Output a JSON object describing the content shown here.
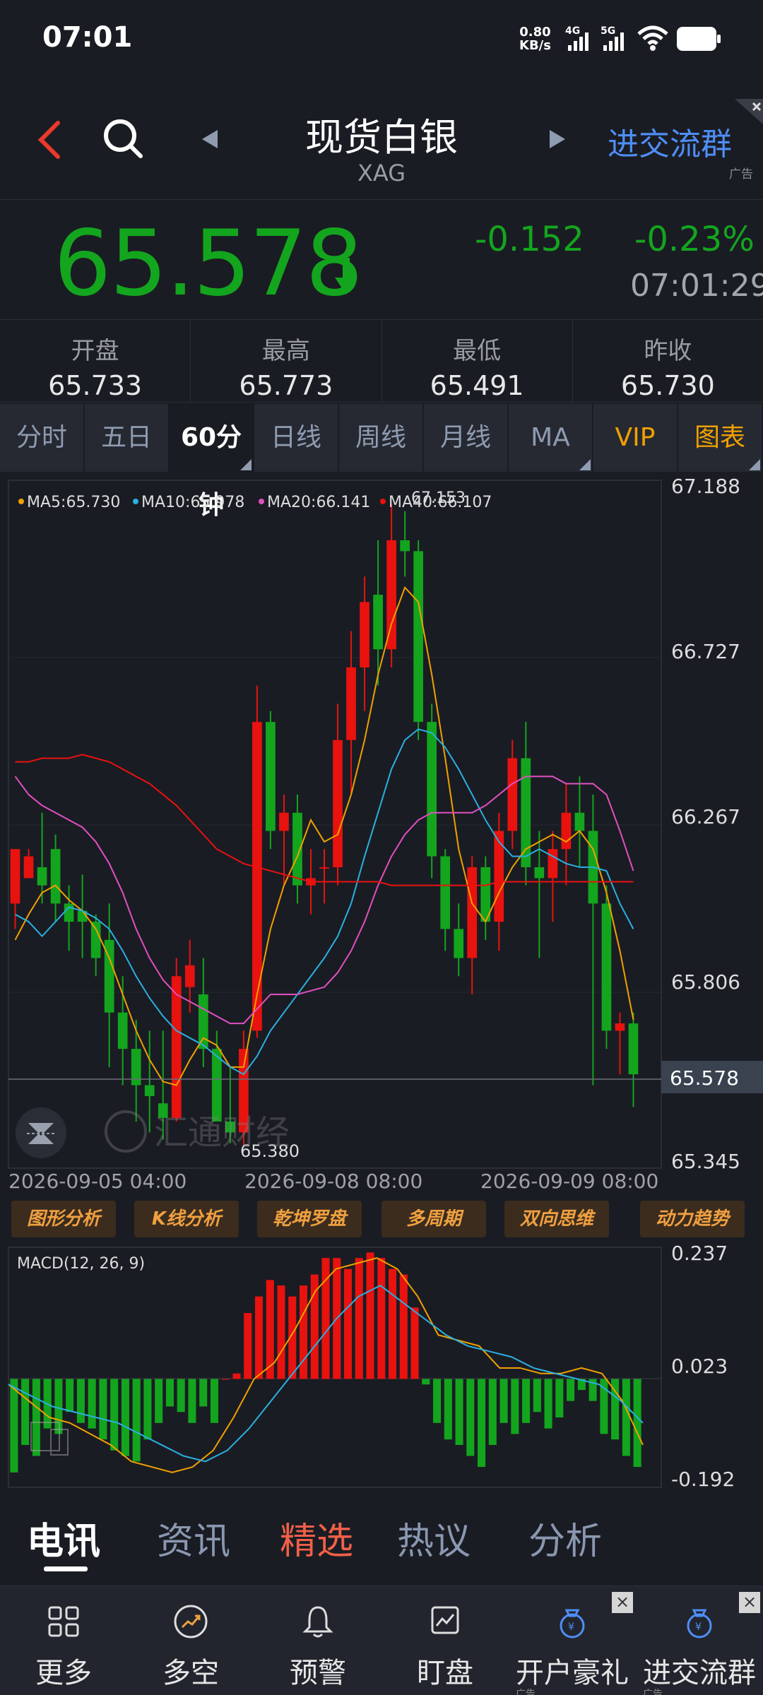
{
  "status": {
    "time": "07:01",
    "net_speed": "0.80",
    "net_unit": "KB/s",
    "sig1": "4G",
    "sig2": "5G"
  },
  "header": {
    "title": "现货白银",
    "subtitle": "XAG",
    "ad_link": "进交流群",
    "ad_tag": "广告"
  },
  "price": {
    "last": "65.578",
    "change": "-0.152",
    "change_pct": "-0.23%",
    "time": "07:01:29",
    "colors": {
      "down": "#13a51e",
      "up": "#e8120f"
    }
  },
  "ohlc": [
    {
      "label": "开盘",
      "value": "65.733"
    },
    {
      "label": "最高",
      "value": "65.773"
    },
    {
      "label": "最低",
      "value": "65.491"
    },
    {
      "label": "昨收",
      "value": "65.730"
    }
  ],
  "tabs": [
    "分时",
    "五日",
    "60分钟",
    "日线",
    "周线",
    "月线",
    "MA",
    "VIP",
    "图表"
  ],
  "ma_legend": [
    {
      "label": "MA5:65.730",
      "color": "#f0a000"
    },
    {
      "label": "MA10:65.978",
      "color": "#2ab0e0"
    },
    {
      "label": "MA20:66.141",
      "color": "#e050c0"
    },
    {
      "label": "MA40:66.107",
      "color": "#e8120f"
    }
  ],
  "kline": {
    "y_ticks": [
      "67.188",
      "66.727",
      "66.267",
      "65.806",
      "65.345"
    ],
    "last_price_label": "65.578",
    "high_label": "67.153",
    "low_label": "65.380",
    "x_labels": [
      "2026-09-05 04:00",
      "2026-09-08 08:00",
      "2026-09-09 08:00"
    ],
    "watermark": "汇通财经"
  },
  "analysis_buttons": [
    "图形分析",
    "K线分析",
    "乾坤罗盘",
    "多周期",
    "双向思维",
    "动力趋势"
  ],
  "macd": {
    "label": "MACD(12, 26, 9)",
    "y_ticks": [
      "0.237",
      "0.023",
      "-0.192"
    ]
  },
  "chart_data": [
    {
      "type": "candlestick",
      "title": "",
      "ylim": [
        65.345,
        67.188
      ],
      "x_labels": [
        "2026-09-05 04:00",
        "2026-09-08 08:00",
        "2026-09-09 08:00"
      ],
      "ohlc": [
        [
          66.05,
          66.18,
          65.98,
          66.2
        ],
        [
          66.12,
          66.2,
          66.15,
          66.18
        ],
        [
          66.15,
          66.3,
          66.05,
          66.1
        ],
        [
          66.2,
          66.24,
          66.0,
          66.05
        ],
        [
          66.05,
          66.1,
          65.92,
          66.0
        ],
        [
          66.03,
          66.13,
          65.9,
          66.0
        ],
        [
          66.0,
          66.02,
          65.85,
          65.9
        ],
        [
          65.95,
          66.05,
          65.6,
          65.75
        ],
        [
          65.75,
          65.85,
          65.55,
          65.65
        ],
        [
          65.65,
          65.73,
          65.45,
          65.55
        ],
        [
          65.55,
          65.7,
          65.42,
          65.52
        ],
        [
          65.5,
          65.7,
          65.4,
          65.46
        ],
        [
          65.46,
          65.9,
          65.45,
          65.85
        ],
        [
          65.82,
          65.95,
          65.75,
          65.88
        ],
        [
          65.8,
          65.9,
          65.6,
          65.65
        ],
        [
          65.65,
          65.7,
          65.45,
          65.45
        ],
        [
          65.45,
          65.6,
          65.39,
          65.42
        ],
        [
          65.42,
          65.7,
          65.38,
          65.65
        ],
        [
          65.7,
          66.65,
          65.68,
          66.55
        ],
        [
          66.55,
          66.58,
          66.2,
          66.25
        ],
        [
          66.25,
          66.35,
          66.1,
          66.3
        ],
        [
          66.3,
          66.35,
          66.05,
          66.1
        ],
        [
          66.1,
          66.2,
          66.02,
          66.12
        ],
        [
          66.15,
          66.2,
          66.05,
          66.15
        ],
        [
          66.15,
          66.6,
          66.1,
          66.5
        ],
        [
          66.5,
          66.8,
          66.35,
          66.7
        ],
        [
          66.7,
          66.95,
          66.58,
          66.88
        ],
        [
          66.9,
          67.05,
          66.65,
          66.75
        ],
        [
          66.75,
          67.15,
          66.7,
          67.05
        ],
        [
          67.05,
          67.13,
          66.95,
          67.02
        ],
        [
          67.02,
          67.05,
          66.5,
          66.55
        ],
        [
          66.55,
          66.6,
          66.12,
          66.18
        ],
        [
          66.18,
          66.2,
          65.92,
          65.98
        ],
        [
          65.98,
          66.05,
          65.85,
          65.9
        ],
        [
          65.9,
          66.18,
          65.8,
          66.15
        ],
        [
          66.15,
          66.18,
          65.95,
          66.0
        ],
        [
          66.0,
          66.3,
          65.92,
          66.25
        ],
        [
          66.25,
          66.5,
          66.2,
          66.45
        ],
        [
          66.45,
          66.55,
          66.1,
          66.15
        ],
        [
          66.15,
          66.25,
          65.9,
          66.12
        ],
        [
          66.12,
          66.25,
          66.0,
          66.2
        ],
        [
          66.2,
          66.38,
          66.1,
          66.3
        ],
        [
          66.3,
          66.4,
          66.15,
          66.25
        ],
        [
          66.25,
          66.35,
          65.55,
          66.05
        ],
        [
          66.05,
          66.1,
          65.65,
          65.7
        ],
        [
          65.7,
          65.75,
          65.58,
          65.72
        ],
        [
          65.72,
          65.75,
          65.49,
          65.58
        ]
      ],
      "series": [
        {
          "name": "MA5",
          "values": [
            65.95,
            66.02,
            66.08,
            66.1,
            66.06,
            66.03,
            65.98,
            65.9,
            65.8,
            65.7,
            65.62,
            65.56,
            65.55,
            65.62,
            65.68,
            65.66,
            65.6,
            65.6,
            65.8,
            65.98,
            66.1,
            66.18,
            66.28,
            66.22,
            66.24,
            66.35,
            66.5,
            66.68,
            66.82,
            66.92,
            66.88,
            66.68,
            66.45,
            66.2,
            66.05,
            66.0,
            66.08,
            66.15,
            66.2,
            66.22,
            66.24,
            66.22,
            66.25,
            66.2,
            66.08,
            65.92,
            65.73
          ]
        },
        {
          "name": "MA10",
          "values": [
            66.02,
            66.0,
            65.96,
            66.0,
            66.04,
            66.03,
            66.01,
            65.98,
            65.92,
            65.85,
            65.79,
            65.74,
            65.7,
            65.68,
            65.66,
            65.63,
            65.6,
            65.58,
            65.63,
            65.7,
            65.75,
            65.8,
            65.85,
            65.9,
            65.96,
            66.05,
            66.18,
            66.3,
            66.42,
            66.5,
            66.53,
            66.52,
            66.48,
            66.42,
            66.35,
            66.28,
            66.22,
            66.18,
            66.18,
            66.2,
            66.18,
            66.16,
            66.15,
            66.15,
            66.14,
            66.05,
            65.98
          ]
        },
        {
          "name": "MA20",
          "values": [
            66.4,
            66.35,
            66.32,
            66.3,
            66.28,
            66.26,
            66.22,
            66.16,
            66.08,
            65.98,
            65.9,
            65.84,
            65.8,
            65.78,
            65.76,
            65.74,
            65.72,
            65.72,
            65.76,
            65.8,
            65.8,
            65.8,
            65.81,
            65.82,
            65.86,
            65.92,
            66.0,
            66.1,
            66.18,
            66.24,
            66.28,
            66.3,
            66.3,
            66.3,
            66.3,
            66.32,
            66.35,
            66.38,
            66.4,
            66.4,
            66.4,
            66.38,
            66.38,
            66.38,
            66.35,
            66.25,
            66.14
          ]
        },
        {
          "name": "MA40",
          "values": [
            66.44,
            66.44,
            66.45,
            66.45,
            66.45,
            66.46,
            66.45,
            66.44,
            66.42,
            66.4,
            66.38,
            66.35,
            66.32,
            66.28,
            66.24,
            66.2,
            66.18,
            66.16,
            66.15,
            66.14,
            66.13,
            66.12,
            66.11,
            66.11,
            66.11,
            66.11,
            66.11,
            66.11,
            66.1,
            66.1,
            66.1,
            66.1,
            66.1,
            66.1,
            66.1,
            66.1,
            66.11,
            66.11,
            66.11,
            66.11,
            66.11,
            66.11,
            66.11,
            66.11,
            66.11,
            66.11,
            66.11
          ]
        }
      ]
    },
    {
      "type": "bar",
      "title": "MACD(12, 26, 9)",
      "ylim": [
        -0.192,
        0.237
      ],
      "values": [
        -0.17,
        -0.12,
        -0.14,
        -0.09,
        -0.1,
        -0.06,
        -0.08,
        -0.09,
        -0.11,
        -0.13,
        -0.14,
        -0.15,
        -0.11,
        -0.08,
        -0.05,
        -0.06,
        -0.08,
        -0.05,
        -0.08,
        0.0,
        0.01,
        0.12,
        0.15,
        0.18,
        0.17,
        0.15,
        0.17,
        0.19,
        0.22,
        0.22,
        0.2,
        0.22,
        0.23,
        0.22,
        0.2,
        0.19,
        0.13,
        -0.01,
        -0.08,
        -0.11,
        -0.12,
        -0.14,
        -0.16,
        -0.12,
        -0.08,
        -0.1,
        -0.08,
        -0.06,
        -0.09,
        -0.07,
        -0.04,
        -0.02,
        -0.04,
        -0.1,
        -0.11,
        -0.14,
        -0.16
      ],
      "series": [
        {
          "name": "DIF",
          "values": [
            -0.01,
            -0.04,
            -0.07,
            -0.08,
            -0.1,
            -0.12,
            -0.15,
            -0.16,
            -0.17,
            -0.16,
            -0.13,
            -0.07,
            0.0,
            0.03,
            0.09,
            0.16,
            0.2,
            0.21,
            0.22,
            0.2,
            0.15,
            0.08,
            0.07,
            0.06,
            0.02,
            0.02,
            0.01,
            0.01,
            0.02,
            0.01,
            -0.04,
            -0.12
          ]
        },
        {
          "name": "DEA",
          "values": [
            -0.01,
            -0.03,
            -0.05,
            -0.06,
            -0.07,
            -0.08,
            -0.1,
            -0.12,
            -0.14,
            -0.15,
            -0.13,
            -0.09,
            -0.04,
            0.01,
            0.06,
            0.11,
            0.15,
            0.17,
            0.14,
            0.11,
            0.08,
            0.06,
            0.05,
            0.04,
            0.02,
            0.01,
            0.0,
            -0.01,
            -0.04,
            -0.08
          ]
        }
      ]
    }
  ],
  "news_tabs": [
    "电讯",
    "资讯",
    "精选",
    "热议",
    "分析"
  ],
  "bottom_nav": [
    {
      "label": "更多",
      "icon": "grid-icon"
    },
    {
      "label": "多空",
      "icon": "trend-icon"
    },
    {
      "label": "预警",
      "icon": "bell-icon"
    },
    {
      "label": "盯盘",
      "icon": "monitor-icon"
    },
    {
      "label": "开户豪礼",
      "icon": "moneybag-icon",
      "ad": "广告"
    },
    {
      "label": "进交流群",
      "icon": "moneybag-icon",
      "ad": "广告"
    }
  ]
}
